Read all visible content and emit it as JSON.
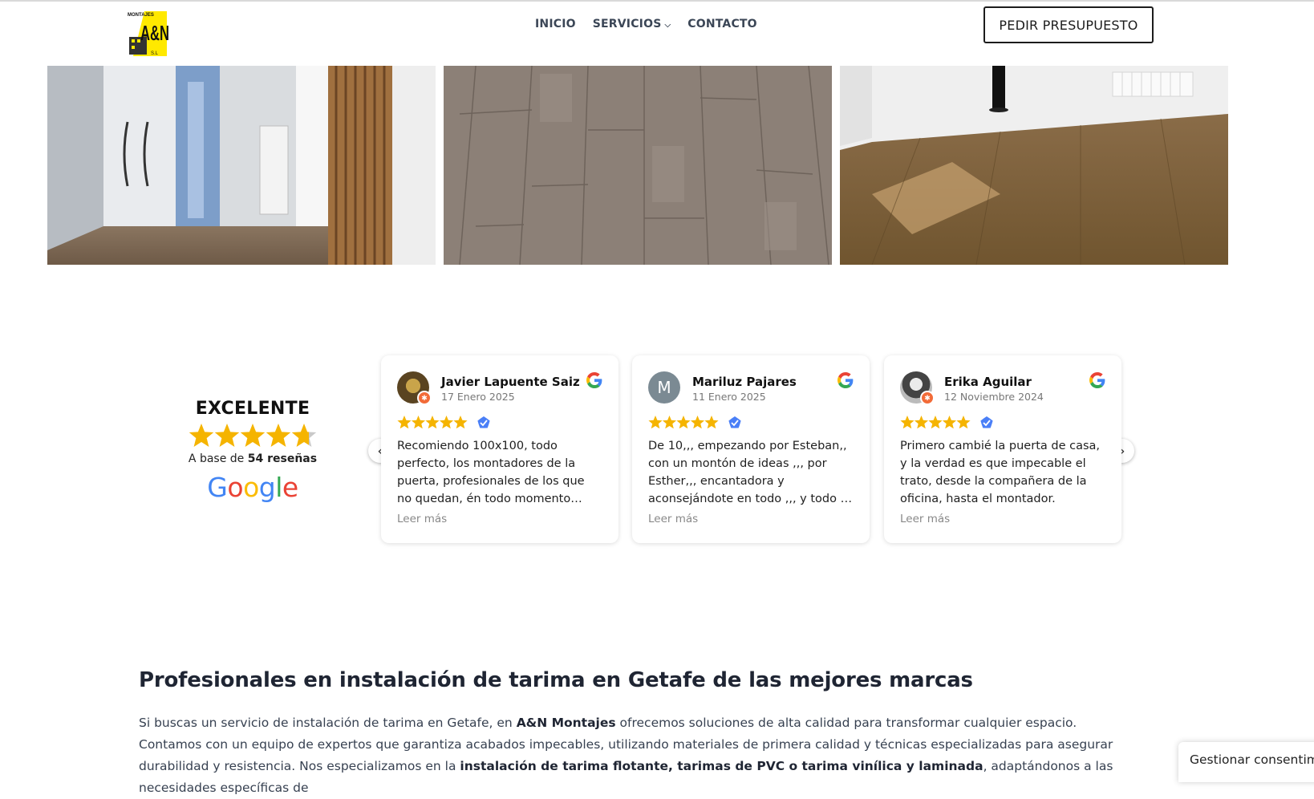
{
  "header": {
    "logo_top_text": "MONTAJES",
    "logo_main_text": "A&N",
    "logo_sub_text": "S.L",
    "nav": [
      {
        "label": "INICIO"
      },
      {
        "label": "SERVICIOS",
        "has_dropdown": true
      },
      {
        "label": "CONTACTO"
      }
    ],
    "cta_label": "PEDIR PRESUPUESTO"
  },
  "summary": {
    "rating_word": "EXCELENTE",
    "rating_value": 4.7,
    "base_prefix": "A base de ",
    "base_count": "54 reseñas",
    "brand": "Google"
  },
  "reviews": [
    {
      "name": "Javier Lapuente Saiz",
      "date": "17 Enero 2025",
      "stars": 5,
      "text": "Recomiendo 100x100, todo perfecto, los montadores de la puerta, profesionales de los que no quedan, én todo momento informándote de todo.",
      "more": "Leer más"
    },
    {
      "name": "Mariluz Pajares",
      "avatar_letter": "M",
      "date": "11 Enero 2025",
      "stars": 5,
      "text": "De 10,,, empezando por Esteban,, con un montón de ideas ,,, por Esther,,, encantadora y aconsejándote en todo ,,, y todo el equipo.",
      "more": "Leer más"
    },
    {
      "name": "Erika Aguilar",
      "date": "12 Noviembre 2024",
      "stars": 5,
      "text": "Primero cambié la puerta de casa, y la verdad es que impecable el trato, desde la compañera de la oficina, hasta el montador.",
      "more": "Leer más"
    }
  ],
  "carousel": {
    "prev": "‹",
    "next": "›"
  },
  "section": {
    "title": "Profesionales en instalación de tarima en Getafe de las mejores marcas",
    "p1": "Si buscas un servicio de instalación de tarima en Getafe, en ",
    "brand": "A&N Montajes",
    "p2": " ofrecemos soluciones de alta calidad para transformar cualquier espacio. Contamos con un equipo de expertos que garantiza acabados impecables, utilizando materiales de primera calidad y técnicas especializadas para asegurar durabilidad y resistencia. Nos especializamos en la ",
    "bold2": "instalación de tarima flotante, tarimas de PVC o tarima vinílica y laminada",
    "p3": ", adaptándonos a las necesidades específicas de"
  },
  "consent_label": "Gestionar consentimiento",
  "colors": {
    "star": "#f5b400",
    "verified": "#4a7ff7",
    "logo_yellow": "#ffe900"
  }
}
